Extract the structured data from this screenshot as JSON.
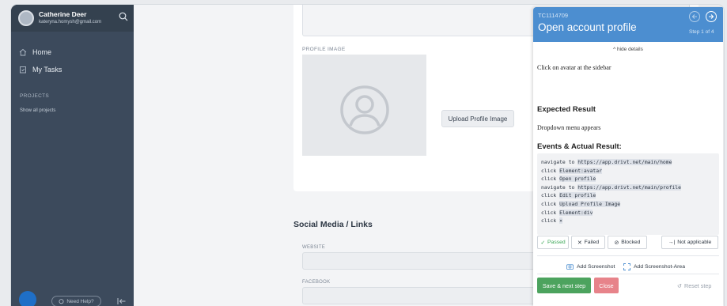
{
  "sidebar": {
    "user_name": "Catherine Deer",
    "user_email": "kateryna.homysh@gmail.com",
    "nav": [
      {
        "label": "Home",
        "icon": "home-icon"
      },
      {
        "label": "My Tasks",
        "icon": "tasks-icon"
      }
    ],
    "projects_heading": "PROJECTS",
    "show_all": "Show all projects",
    "help_label": "Need Help?"
  },
  "main": {
    "profile_image_label": "PROFILE IMAGE",
    "upload_button": "Upload Profile Image",
    "social_title": "Social Media / Links",
    "website_label": "WEBSITE",
    "facebook_label": "FACEBOOK"
  },
  "panel": {
    "tc_id": "TC1114709",
    "title": "Open account profile",
    "step": "Step 1 of 4",
    "hide_details": "hide details",
    "action": "Click on avatar at the sidebar",
    "expected_heading": "Expected Result",
    "expected": "Dropdown menu appears",
    "events_heading": "Events & Actual Result:",
    "events": [
      {
        "verb": "navigate to",
        "arg": "https://app.drivt.net/main/home"
      },
      {
        "verb": "click",
        "arg": "Element:avatar"
      },
      {
        "verb": "click",
        "arg": "Open profile"
      },
      {
        "verb": "navigate to",
        "arg": "https://app.drivt.net/main/profile"
      },
      {
        "verb": "click",
        "arg": "Edit profile"
      },
      {
        "verb": "click",
        "arg": "Upload Profile Image"
      },
      {
        "verb": "click",
        "arg": "Element:div"
      },
      {
        "verb": "click",
        "arg": "×"
      }
    ],
    "status": {
      "passed": "Passed",
      "failed": "Failed",
      "blocked": "Blocked",
      "not_applicable": "Not applicable"
    },
    "add_screenshot": "Add Screenshot",
    "add_screenshot_area": "Add Screenshot-Area",
    "save_next": "Save & next step",
    "close": "Close",
    "reset": "Reset step",
    "colors": {
      "header": "#4c8ed0",
      "save": "#4ca35e",
      "close": "#e7838a",
      "sidebar": "#3c4a5c"
    }
  }
}
